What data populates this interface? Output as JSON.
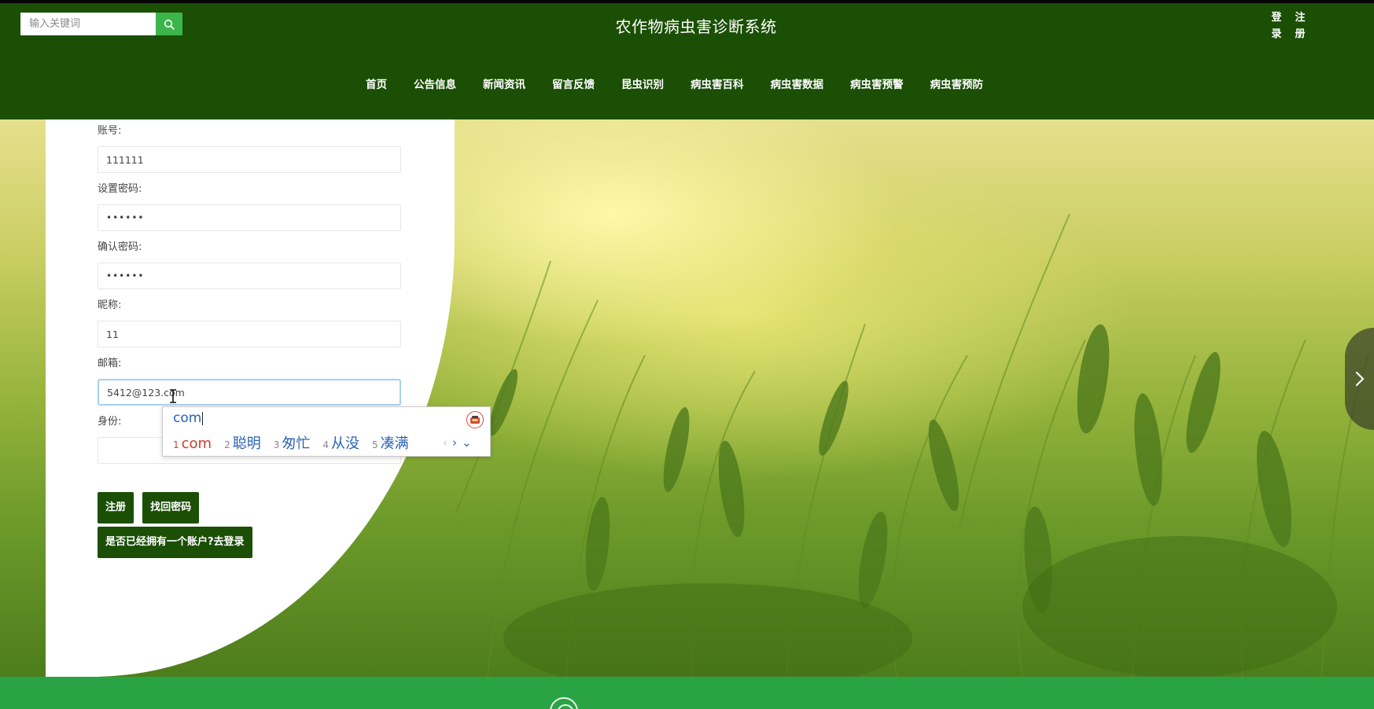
{
  "header": {
    "search_placeholder": "输入关键词",
    "site_title": "农作物病虫害诊断系统",
    "login": "登录",
    "register": "注册"
  },
  "nav": {
    "items": [
      "首页",
      "公告信息",
      "新闻资讯",
      "留言反馈",
      "昆虫识别",
      "病虫害百科",
      "病虫害数据",
      "病虫害预警",
      "病虫害预防"
    ]
  },
  "form": {
    "account_label": "账号:",
    "account_value": "111111",
    "password_label": "设置密码:",
    "password_value": "••••••",
    "confirm_label": "确认密码:",
    "confirm_value": "••••••",
    "nickname_label": "昵称:",
    "nickname_value": "11",
    "email_label": "邮箱:",
    "email_value": "5412@123.com",
    "role_label": "身份:",
    "role_value": ""
  },
  "buttons": {
    "register": "注册",
    "find_password": "找回密码",
    "go_login": "是否已经拥有一个账户?去登录"
  },
  "ime": {
    "composition": "com",
    "candidates": [
      {
        "num": "1",
        "text": "com"
      },
      {
        "num": "2",
        "text": "聪明"
      },
      {
        "num": "3",
        "text": "匆忙"
      },
      {
        "num": "4",
        "text": "从没"
      },
      {
        "num": "5",
        "text": "凑满"
      }
    ]
  },
  "colors": {
    "header_bg": "#1a4f05",
    "search_button": "#3cb54a",
    "footer_bg": "#2aa345",
    "ime_candidate": "#2a62b4",
    "ime_first_candidate": "#d23c2c"
  },
  "icons": {
    "search": "search-icon",
    "next_slide": "chevron-right-icon",
    "ime_logo": "ime-logo-icon",
    "footer": "footer-logo-icon"
  }
}
